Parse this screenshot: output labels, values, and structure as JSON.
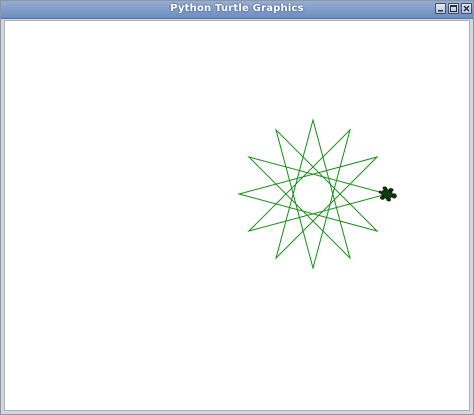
{
  "window": {
    "title": "Python Turtle Graphics",
    "controls": {
      "minimize_icon": "minimize-icon",
      "maximize_icon": "maximize-icon",
      "close_icon": "close-icon"
    }
  },
  "drawing": {
    "shape": "star-polygon",
    "points": 12,
    "step": 5,
    "stroke_color": "#1a8a1a",
    "turtle_color": "#0b3d0b"
  }
}
